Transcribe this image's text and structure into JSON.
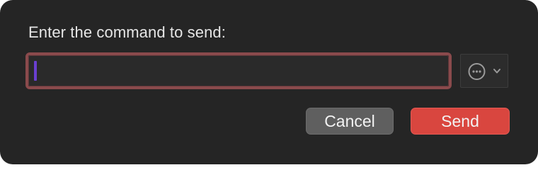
{
  "dialog": {
    "prompt": "Enter the command to send:",
    "command_input": {
      "value": "",
      "placeholder": ""
    },
    "options_button": {
      "icon": "ellipsis-circle-icon",
      "dropdown_icon": "chevron-down-icon"
    },
    "buttons": {
      "cancel_label": "Cancel",
      "send_label": "Send"
    }
  },
  "colors": {
    "dialog_background": "#252525",
    "input_focus_ring": "#8a4a4c",
    "caret": "#6a3fd0",
    "send_button": "#d9463f",
    "cancel_button": "#5f5f5f"
  }
}
